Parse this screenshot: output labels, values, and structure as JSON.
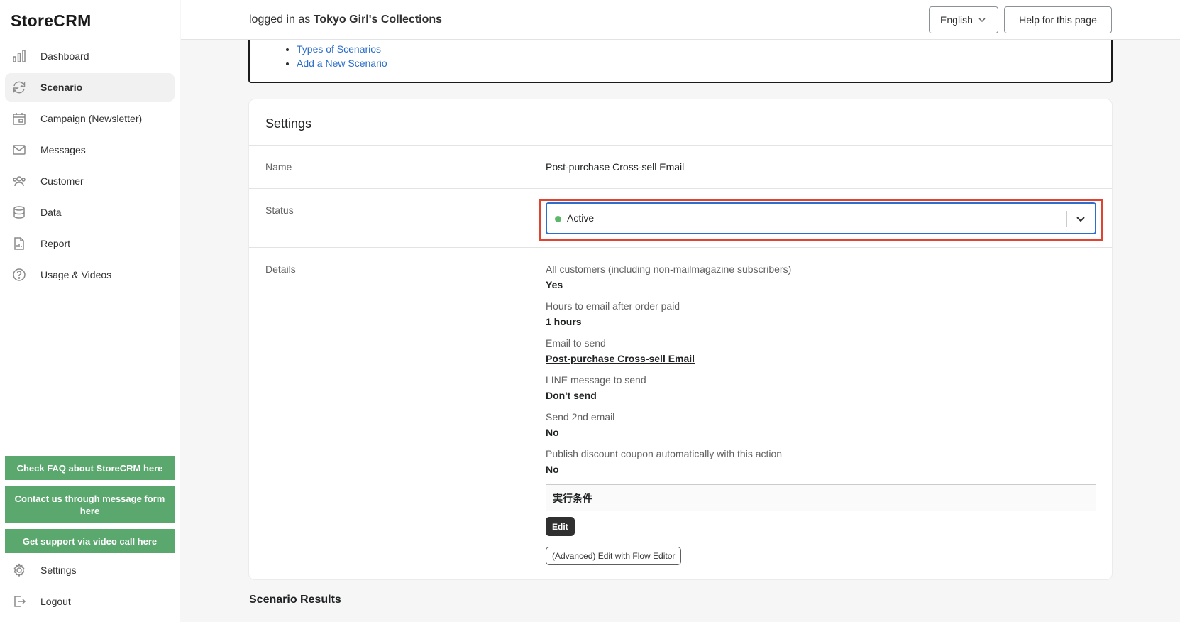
{
  "app": {
    "logo": "StoreCRM"
  },
  "sidebar": {
    "items": [
      {
        "label": "Dashboard",
        "icon": "bar-chart-icon"
      },
      {
        "label": "Scenario",
        "icon": "refresh-icon"
      },
      {
        "label": "Campaign (Newsletter)",
        "icon": "calendar-icon"
      },
      {
        "label": "Messages",
        "icon": "envelope-icon"
      },
      {
        "label": "Customer",
        "icon": "users-icon"
      },
      {
        "label": "Data",
        "icon": "database-icon"
      },
      {
        "label": "Report",
        "icon": "report-icon"
      },
      {
        "label": "Usage & Videos",
        "icon": "question-icon"
      }
    ],
    "active_item": "Scenario",
    "support_buttons": [
      "Check FAQ about StoreCRM here",
      "Contact us through message form here",
      "Get support via video call here"
    ],
    "bottom_items": [
      {
        "label": "Settings",
        "icon": "gear-icon"
      },
      {
        "label": "Logout",
        "icon": "logout-icon"
      }
    ]
  },
  "header": {
    "login_prefix": "logged in as",
    "store_name": "Tokyo Girl's Collections",
    "language": "English",
    "help_button": "Help for this page"
  },
  "help_links": [
    "Types of Scenarios",
    "Add a New Scenario"
  ],
  "settings": {
    "title": "Settings",
    "name_label": "Name",
    "name_value": "Post-purchase Cross-sell Email",
    "status_label": "Status",
    "status_value": "Active",
    "details_label": "Details",
    "details": [
      {
        "label": "All customers (including non-mailmagazine subscribers)",
        "value": "Yes"
      },
      {
        "label": "Hours to email after order paid",
        "value": "1 hours"
      },
      {
        "label": "Email to send",
        "value": "Post-purchase Cross-sell Email",
        "link": true
      },
      {
        "label": "LINE message to send",
        "value": "Don't send"
      },
      {
        "label": "Send 2nd email",
        "value": "No"
      },
      {
        "label": "Publish discount coupon automatically with this action",
        "value": "No"
      }
    ],
    "condition_box": "実行条件",
    "edit_button": "Edit",
    "flow_button": "(Advanced) Edit with Flow Editor"
  },
  "results": {
    "title": "Scenario Results"
  },
  "colors": {
    "accent_green": "#5ba86f",
    "status_green": "#5bb86a",
    "focus_blue": "#2c6ecb",
    "highlight_red": "#e0432f"
  }
}
